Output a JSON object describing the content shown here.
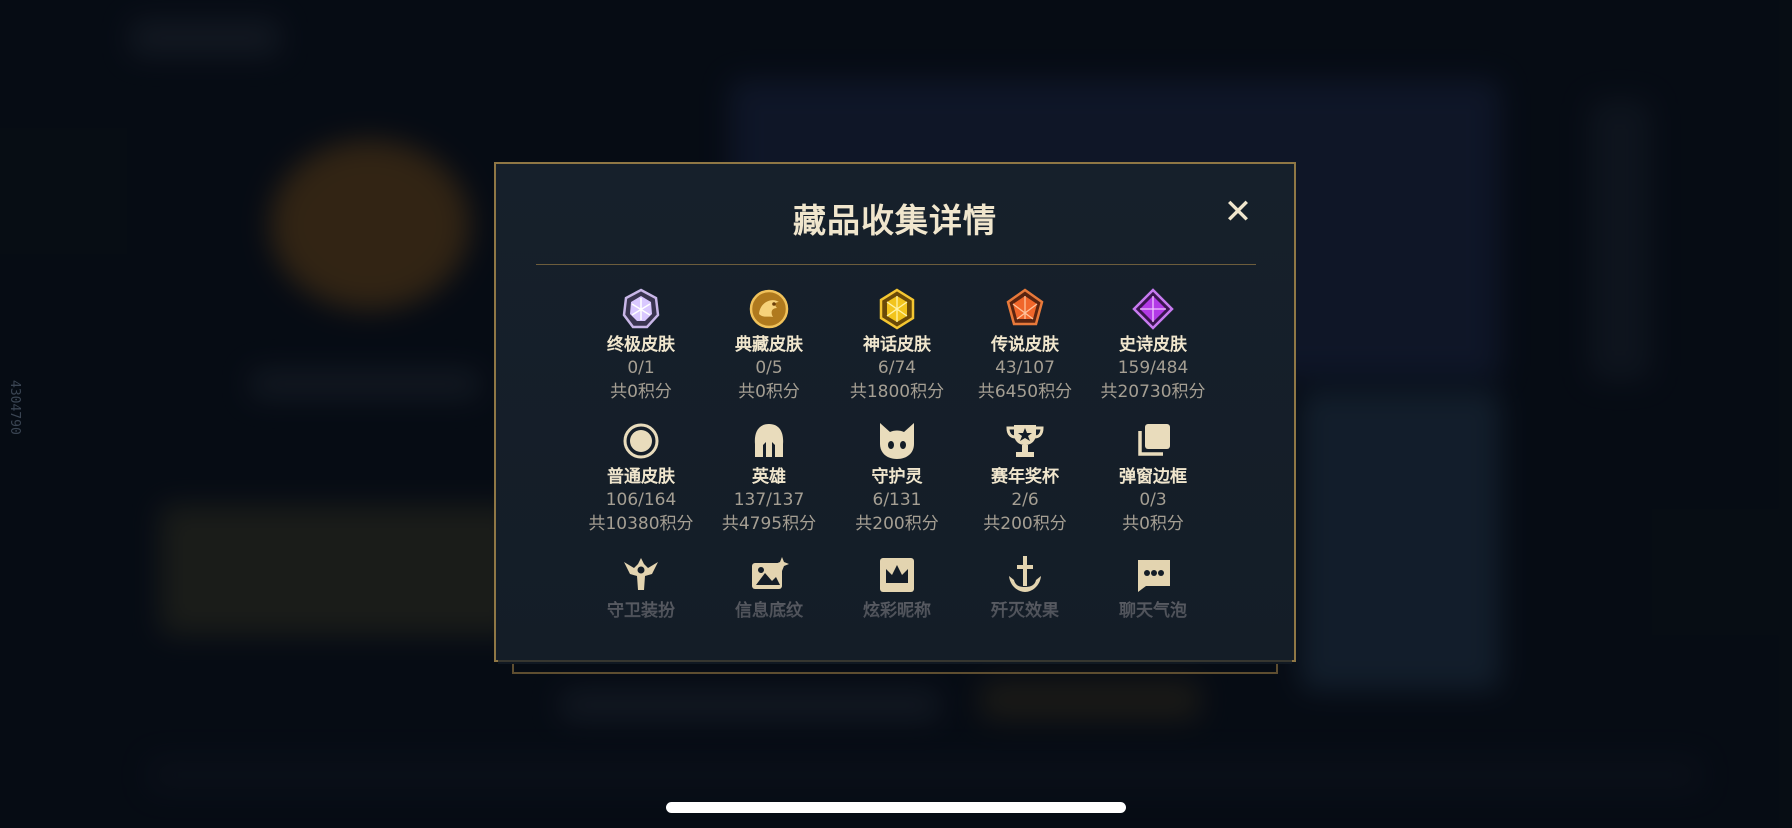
{
  "background": {
    "side_id": "4304790"
  },
  "modal": {
    "title": "藏品收集详情",
    "close_label": "✕"
  },
  "items_row1": [
    {
      "name": "终极皮肤",
      "count": "0/1",
      "points": "共0积分",
      "icon": "ultimate-gem-icon"
    },
    {
      "name": "典藏皮肤",
      "count": "0/5",
      "points": "共0积分",
      "icon": "dragon-medal-icon"
    },
    {
      "name": "神话皮肤",
      "count": "6/74",
      "points": "共1800积分",
      "icon": "mythic-gem-icon"
    },
    {
      "name": "传说皮肤",
      "count": "43/107",
      "points": "共6450积分",
      "icon": "legendary-gem-icon"
    },
    {
      "name": "史诗皮肤",
      "count": "159/484",
      "points": "共20730积分",
      "icon": "epic-gem-icon"
    }
  ],
  "items_row2": [
    {
      "name": "普通皮肤",
      "count": "106/164",
      "points": "共10380积分",
      "icon": "circle-icon"
    },
    {
      "name": "英雄",
      "count": "137/137",
      "points": "共4795积分",
      "icon": "helmet-icon"
    },
    {
      "name": "守护灵",
      "count": "6/131",
      "points": "共200积分",
      "icon": "cat-face-icon"
    },
    {
      "name": "赛年奖杯",
      "count": "2/6",
      "points": "共200积分",
      "icon": "trophy-icon"
    },
    {
      "name": "弹窗边框",
      "count": "0/3",
      "points": "共0积分",
      "icon": "stacked-frames-icon"
    }
  ],
  "items_row3": [
    {
      "name": "守卫装扮",
      "icon": "ward-icon"
    },
    {
      "name": "信息底纹",
      "icon": "image-sparkle-icon"
    },
    {
      "name": "炫彩昵称",
      "icon": "crown-card-icon"
    },
    {
      "name": "歼灭效果",
      "icon": "anchor-sword-icon"
    },
    {
      "name": "聊天气泡",
      "icon": "chat-bubble-icon"
    }
  ],
  "colors": {
    "gold_border": "#8f7745",
    "title": "#f0e6cd",
    "secondary_text": "#a59f93"
  }
}
